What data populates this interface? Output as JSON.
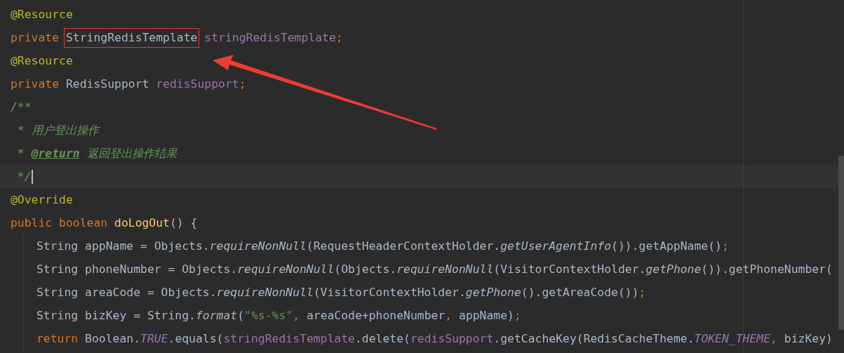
{
  "editor": {
    "lines": [
      {
        "current": false,
        "tokens": [
          {
            "kind": "annotation",
            "text": "@Resource"
          }
        ]
      },
      {
        "current": false,
        "tokens": [
          {
            "kind": "keyword",
            "text": "private "
          },
          {
            "kind": "plain",
            "text": "StringRedisTemplate",
            "boxed": true
          },
          {
            "kind": "field",
            "text": " stringRedisTemplate"
          },
          {
            "kind": "punct",
            "text": ";"
          }
        ]
      },
      {
        "current": false,
        "tokens": [
          {
            "kind": "annotation",
            "text": "@Resource"
          }
        ]
      },
      {
        "current": false,
        "tokens": [
          {
            "kind": "keyword",
            "text": "private "
          },
          {
            "kind": "plain",
            "text": "RedisSupport "
          },
          {
            "kind": "field",
            "text": "redisSupport"
          },
          {
            "kind": "punct",
            "text": ";"
          }
        ]
      },
      {
        "current": false,
        "tokens": [
          {
            "kind": "comment",
            "text": "/**"
          }
        ]
      },
      {
        "current": false,
        "tokens": [
          {
            "kind": "comment",
            "text": " * 用户登出操作"
          }
        ]
      },
      {
        "current": false,
        "tokens": [
          {
            "kind": "comment",
            "text": " * "
          },
          {
            "kind": "doc-tag",
            "text": "@return"
          },
          {
            "kind": "comment",
            "text": " 返回登出操作结果"
          }
        ]
      },
      {
        "current": true,
        "tokens": [
          {
            "kind": "comment",
            "text": " */"
          }
        ]
      },
      {
        "current": false,
        "tokens": [
          {
            "kind": "annotation",
            "text": "@Override"
          }
        ]
      },
      {
        "current": false,
        "tokens": [
          {
            "kind": "keyword",
            "text": "public boolean "
          },
          {
            "kind": "method-decl",
            "text": "doLogOut"
          },
          {
            "kind": "plain",
            "text": "() {"
          }
        ],
        "children": [
          {
            "current": false,
            "tokens": [
              {
                "kind": "plain",
                "text": "String appName = Objects."
              },
              {
                "kind": "static-call",
                "text": "requireNonNull"
              },
              {
                "kind": "plain",
                "text": "(RequestHeaderContextHolder."
              },
              {
                "kind": "static-call",
                "text": "getUserAgentInfo"
              },
              {
                "kind": "plain",
                "text": "()).getAppName()"
              },
              {
                "kind": "punct",
                "text": ";"
              }
            ]
          },
          {
            "current": false,
            "tokens": [
              {
                "kind": "plain",
                "text": "String phoneNumber = Objects."
              },
              {
                "kind": "static-call",
                "text": "requireNonNull"
              },
              {
                "kind": "plain",
                "text": "(Objects."
              },
              {
                "kind": "static-call",
                "text": "requireNonNull"
              },
              {
                "kind": "plain",
                "text": "(VisitorContextHolder."
              },
              {
                "kind": "static-call",
                "text": "getPhone"
              },
              {
                "kind": "plain",
                "text": "()).getPhoneNumber("
              }
            ]
          },
          {
            "current": false,
            "tokens": [
              {
                "kind": "plain",
                "text": "String areaCode = Objects."
              },
              {
                "kind": "static-call",
                "text": "requireNonNull"
              },
              {
                "kind": "plain",
                "text": "(VisitorContextHolder."
              },
              {
                "kind": "static-call",
                "text": "getPhone"
              },
              {
                "kind": "plain",
                "text": "().getAreaCode())"
              },
              {
                "kind": "punct",
                "text": ";"
              }
            ]
          },
          {
            "current": false,
            "tokens": [
              {
                "kind": "plain",
                "text": "String bizKey = String."
              },
              {
                "kind": "static-call",
                "text": "format"
              },
              {
                "kind": "plain",
                "text": "("
              },
              {
                "kind": "string",
                "text": "\"%s-%s\""
              },
              {
                "kind": "punct",
                "text": ", "
              },
              {
                "kind": "plain",
                "text": "areaCode+phoneNumber"
              },
              {
                "kind": "punct",
                "text": ", "
              },
              {
                "kind": "plain",
                "text": "appName)"
              },
              {
                "kind": "punct",
                "text": ";"
              }
            ]
          },
          {
            "current": false,
            "tokens": [
              {
                "kind": "keyword",
                "text": "return "
              },
              {
                "kind": "plain",
                "text": "Boolean."
              },
              {
                "kind": "constant",
                "text": "TRUE"
              },
              {
                "kind": "plain",
                "text": ".equals("
              },
              {
                "kind": "field",
                "text": "stringRedisTemplate"
              },
              {
                "kind": "plain",
                "text": ".delete("
              },
              {
                "kind": "field",
                "text": "redisSupport"
              },
              {
                "kind": "plain",
                "text": ".getCacheKey(RedisCacheTheme."
              },
              {
                "kind": "constant",
                "text": "TOKEN_THEME"
              },
              {
                "kind": "punct",
                "text": ", "
              },
              {
                "kind": "plain",
                "text": "bizKey)"
              }
            ]
          }
        ]
      }
    ]
  }
}
